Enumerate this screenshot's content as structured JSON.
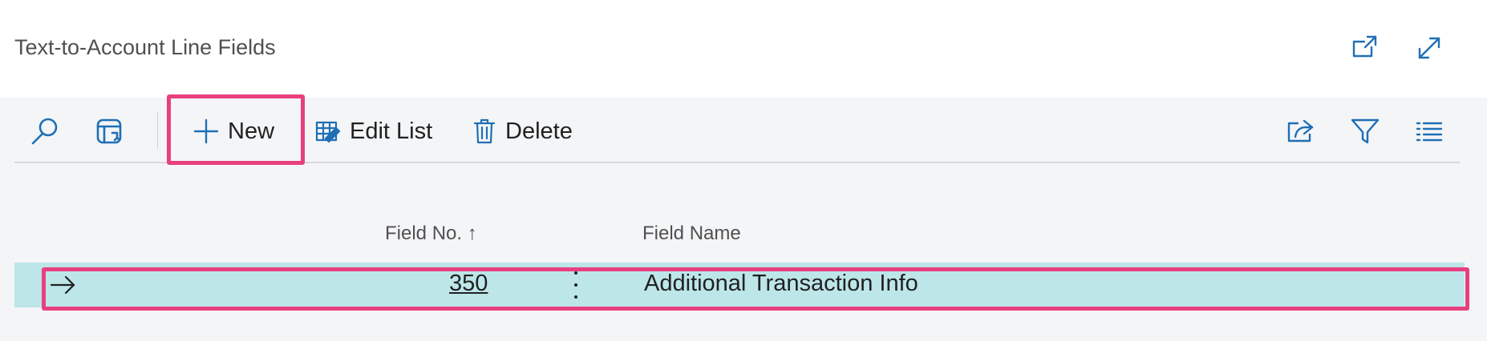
{
  "header": {
    "title": "Text-to-Account Line Fields",
    "icons": [
      "open-in-new-window-icon",
      "expand-icon"
    ]
  },
  "toolbar": {
    "search_icon": "search-icon",
    "layout_icon": "show-as-tiles-icon",
    "new_label": "New",
    "edit_list_label": "Edit List",
    "delete_label": "Delete",
    "right_icons": [
      "share-icon",
      "filter-icon",
      "list-view-icon"
    ]
  },
  "table": {
    "columns": [
      "Field No. ↑",
      "Field Name"
    ],
    "rows": [
      {
        "field_no": "350",
        "field_name": "Additional Transaction Info"
      }
    ]
  },
  "colors": {
    "accent_highlight": "#e8407f",
    "selected_row": "#bde6e9",
    "panel_bg": "#f4f5f7"
  }
}
